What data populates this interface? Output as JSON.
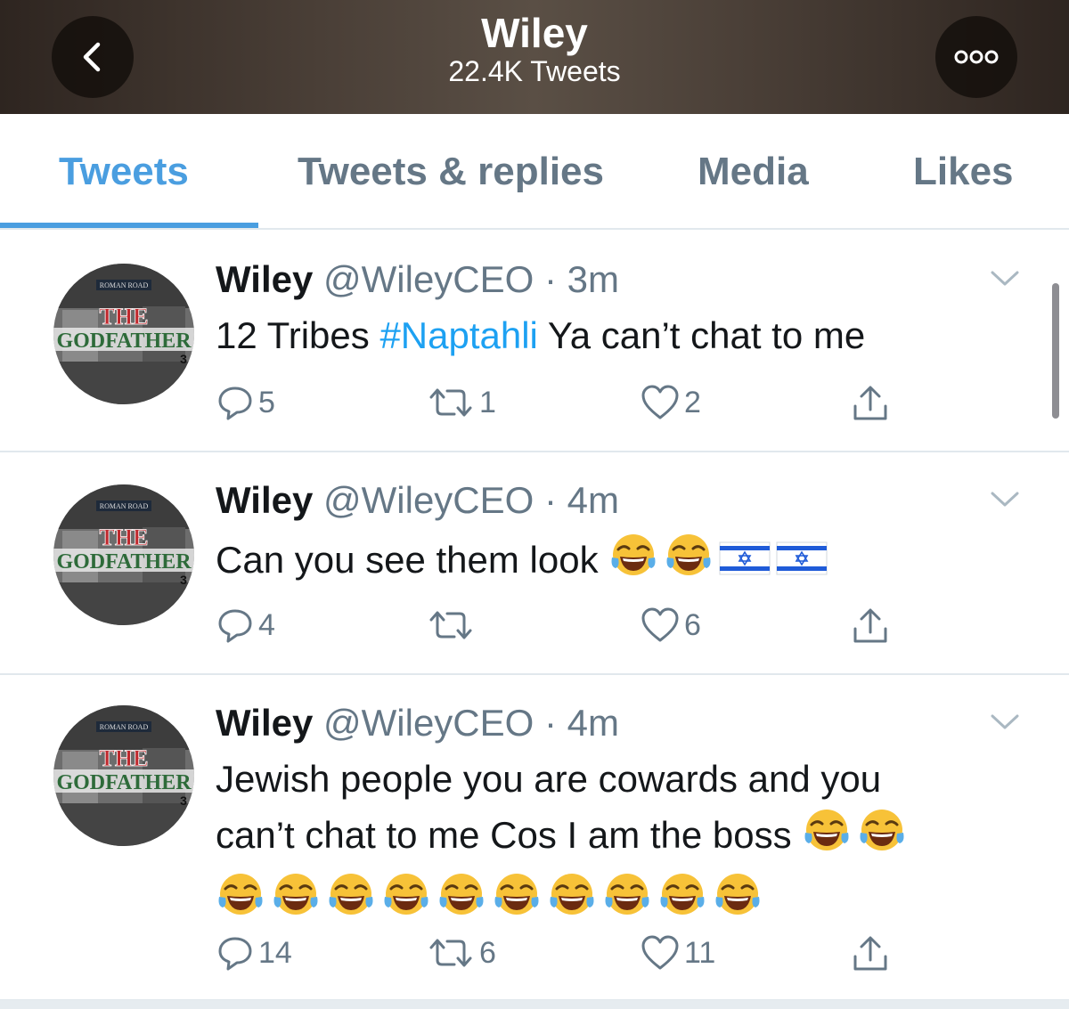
{
  "header": {
    "title": "Wiley",
    "subtitle": "22.4K Tweets",
    "back_icon": "chevron-left-icon",
    "more_icon": "ellipsis-icon"
  },
  "tabs": [
    {
      "label": "Tweets",
      "active": true
    },
    {
      "label": "Tweets & replies",
      "active": false
    },
    {
      "label": "Media",
      "active": false
    },
    {
      "label": "Likes",
      "active": false
    }
  ],
  "colors": {
    "accent": "#1da1f2",
    "tab_active": "#4a9ee0",
    "muted": "#657786"
  },
  "tweets": [
    {
      "name": "Wiley",
      "handle": "@WileyCEO",
      "time": "3m",
      "text_before": "12 Tribes ",
      "hashtag": "#Naptahli",
      "text_after": " Ya can’t chat to me",
      "replies": "5",
      "retweets": "1",
      "likes": "2"
    },
    {
      "name": "Wiley",
      "handle": "@WileyCEO",
      "time": "4m",
      "text": "Can you see them look",
      "emoji": [
        "face-with-tears-of-joy",
        "face-with-tears-of-joy",
        "flag-israel",
        "flag-israel"
      ],
      "replies": "4",
      "retweets": "",
      "likes": "6"
    },
    {
      "name": "Wiley",
      "handle": "@WileyCEO",
      "time": "4m",
      "text_line1": "Jewish people you are cowards and you",
      "text_line2": "can’t chat to me Cos I am the boss",
      "emoji_count": 12,
      "replies": "14",
      "retweets": "6",
      "likes": "11"
    }
  ],
  "avatar": {
    "text_top": "THE",
    "text_main": "GODFATHER",
    "text_num": "3",
    "text_road": "ROMAN ROAD"
  },
  "separator": " · "
}
